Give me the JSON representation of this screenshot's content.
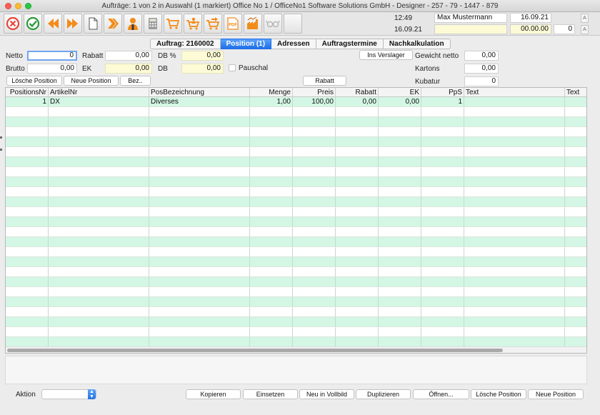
{
  "window": {
    "title": "Aufträge: 1 von 2 in Auswahl  (1 markiert) Office No 1 /  OfficeNo1 Software Solutions GmbH - Designer - 257 - 79 - 1447 - 879"
  },
  "toolbar": {
    "buttons": [
      {
        "name": "cancel-icon",
        "color": "#e8443a"
      },
      {
        "name": "confirm-check-icon",
        "color": "#2e9a3c"
      },
      {
        "name": "previous-arrow-icon",
        "color": "#f28c1a"
      },
      {
        "name": "next-arrow-icon",
        "color": "#f28c1a"
      },
      {
        "name": "new-document-icon",
        "color": "#ffffff"
      },
      {
        "name": "forward-chevron-icon",
        "color": "#f28c1a"
      },
      {
        "name": "person-icon",
        "color": "#f28c1a"
      },
      {
        "name": "calculator-icon",
        "color": "#8a8a8a"
      },
      {
        "name": "shopping-cart-icon",
        "color": "#f28c1a"
      },
      {
        "name": "cart-person-icon",
        "color": "#f28c1a"
      },
      {
        "name": "cart-arrow-icon",
        "color": "#f28c1a"
      },
      {
        "name": "pdf-icon",
        "color": "#f28c1a"
      },
      {
        "name": "factory-chart-icon",
        "color": "#f28c1a"
      },
      {
        "name": "glasses-icon",
        "color": "#c9c9c9"
      },
      {
        "name": "empty-icon",
        "color": "#ffffff"
      }
    ]
  },
  "header_info": {
    "time": "12:49",
    "user": "Max Mustermann",
    "date_top": "16.09.21",
    "date_left": "16.09.21",
    "amount": "00.00.00",
    "counter": "0",
    "btn_a1": "A",
    "btn_a2": "A"
  },
  "tabs": [
    {
      "label": "Auftrag: 2160002",
      "active": false
    },
    {
      "label": "Position (1)",
      "active": true
    },
    {
      "label": "Adressen",
      "active": false
    },
    {
      "label": "Auftragstermine",
      "active": false
    },
    {
      "label": "Nachkalkulation",
      "active": false
    }
  ],
  "form": {
    "netto_label": "Netto",
    "netto_value": "0",
    "rabatt_label": "Rabatt",
    "rabatt_value": "0,00",
    "db_pct_label": "DB %",
    "db_pct_value": "0,00",
    "brutto_label": "Brutto",
    "brutto_value": "0,00",
    "ek_label": "EK",
    "ek_value": "0,00",
    "db_label": "DB",
    "db_value": "0,00",
    "pauschal_label": "Pauschal",
    "ins_verslager": "Ins Verslager",
    "gewicht_label": "Gewicht netto",
    "gewicht_value": "0,00",
    "kartons_label": "Kartons",
    "kartons_value": "0,00",
    "kubatur_label": "Kubatur",
    "kubatur_value": "0",
    "btn_loesche": "Lösche Position",
    "btn_neue": "Neue Position",
    "btn_bez": "Bez..",
    "btn_rabatt": "Rabatt"
  },
  "grid": {
    "columns": [
      "PositionsNr",
      "ArtikelNr",
      "PosBezeichnung",
      "Menge",
      "Preis",
      "Rabatt",
      "EK",
      "PpS",
      "Text",
      "Text"
    ],
    "rows": [
      {
        "positionsnr": "1",
        "artikelnr": "DX",
        "posbezeichnung": "Diverses",
        "menge": "1,00",
        "preis": "100,00",
        "rabatt": "0,00",
        "ek": "0,00",
        "pps": "1",
        "text": "",
        "text2": ""
      }
    ],
    "row_colors": {
      "even": "#d3f7e4",
      "odd": "#ffffff"
    }
  },
  "footer": {
    "aktion_label": "Aktion",
    "aktion_value": "",
    "buttons": [
      "Kopieren",
      "Einsetzen",
      "Neu in Vollbild",
      "Duplizieren",
      "Öffnen...",
      "Lösche Position",
      "Neue Position"
    ]
  }
}
